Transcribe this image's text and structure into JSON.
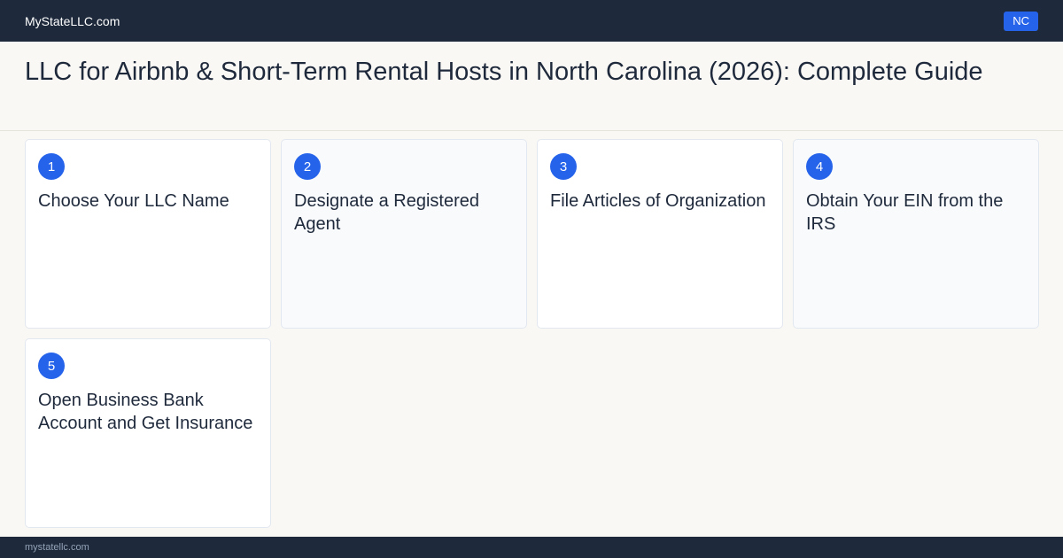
{
  "header": {
    "brand": "MyStateLLC.com",
    "state_badge": "NC"
  },
  "page": {
    "title": "LLC for Airbnb & Short-Term Rental Hosts in North Carolina (2026): Complete Guide"
  },
  "steps": [
    {
      "number": "1",
      "title": "Choose Your LLC Name"
    },
    {
      "number": "2",
      "title": "Designate a Registered Agent"
    },
    {
      "number": "3",
      "title": "File Articles of Organization"
    },
    {
      "number": "4",
      "title": "Obtain Your EIN from the IRS"
    },
    {
      "number": "5",
      "title": "Open Business Bank Account and Get Insurance"
    }
  ],
  "footer": {
    "domain": "mystatellc.com"
  },
  "colors": {
    "nav_bg": "#1e293b",
    "accent": "#2563eb",
    "page_bg": "#faf8f5"
  }
}
